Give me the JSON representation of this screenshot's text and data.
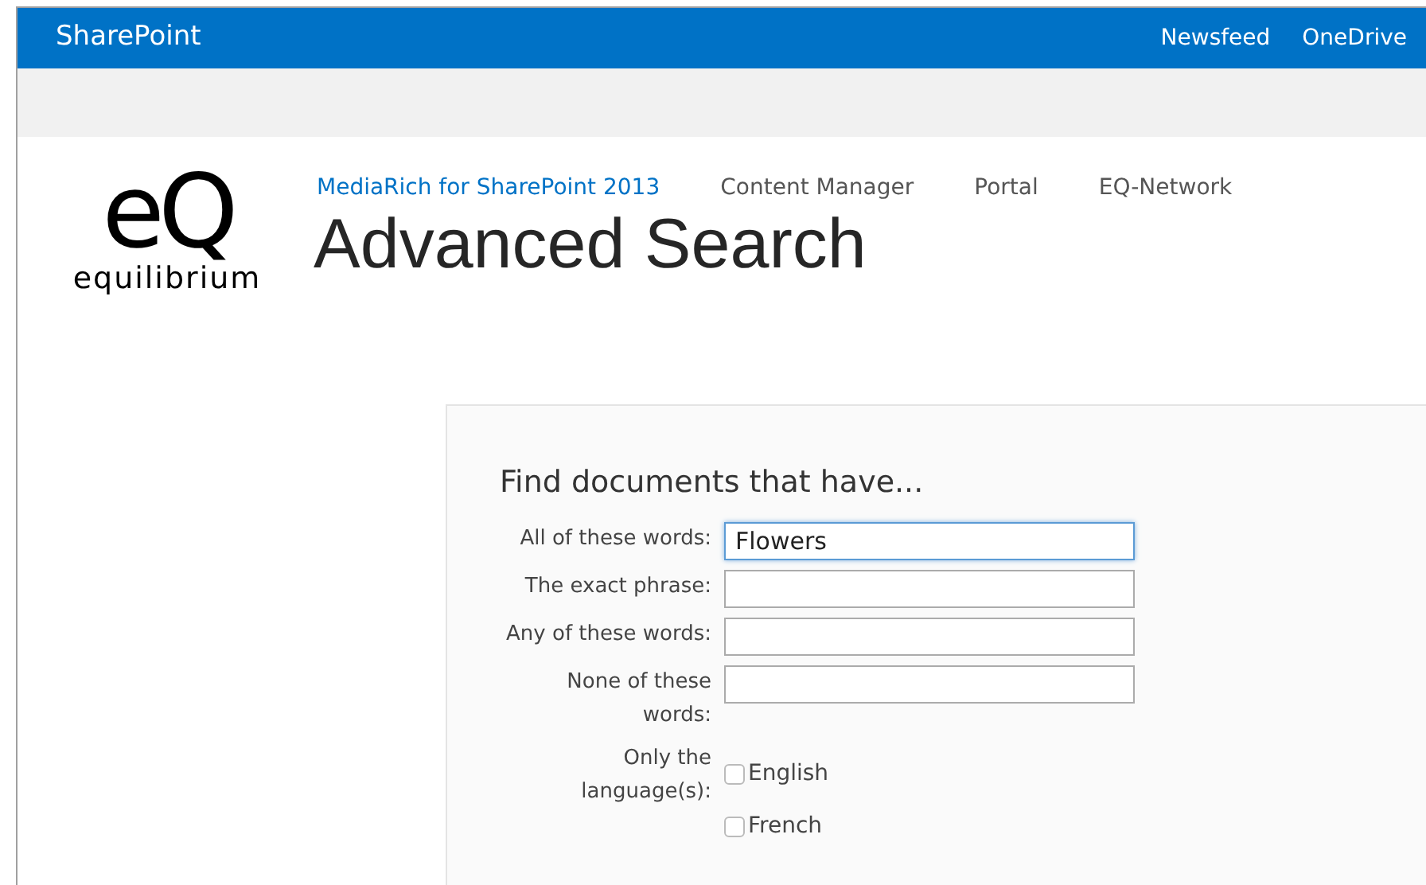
{
  "top_bar": {
    "brand": "SharePoint",
    "links": [
      "Newsfeed",
      "OneDrive"
    ]
  },
  "logo": {
    "mark": "eQ",
    "wordmark": "equilibrium"
  },
  "nav": [
    {
      "label": "MediaRich for SharePoint 2013",
      "selected": true
    },
    {
      "label": "Content Manager",
      "selected": false
    },
    {
      "label": "Portal",
      "selected": false
    },
    {
      "label": "EQ-Network",
      "selected": false
    }
  ],
  "page_title": "Advanced Search",
  "form": {
    "heading": "Find documents that have...",
    "fields": [
      {
        "kind": "text",
        "label": "All of these words:",
        "value": "Flowers",
        "focused": true
      },
      {
        "kind": "text",
        "label": "The exact phrase:",
        "focused": false
      },
      {
        "kind": "text",
        "label": "Any of these words:",
        "focused": false
      },
      {
        "kind": "text",
        "label": "None of these words:",
        "focused": false
      },
      {
        "kind": "checkboxes",
        "label": "Only the language(s):",
        "options": [
          {
            "label": "English",
            "checked": false
          },
          {
            "label": "French",
            "checked": false
          }
        ]
      }
    ]
  }
}
